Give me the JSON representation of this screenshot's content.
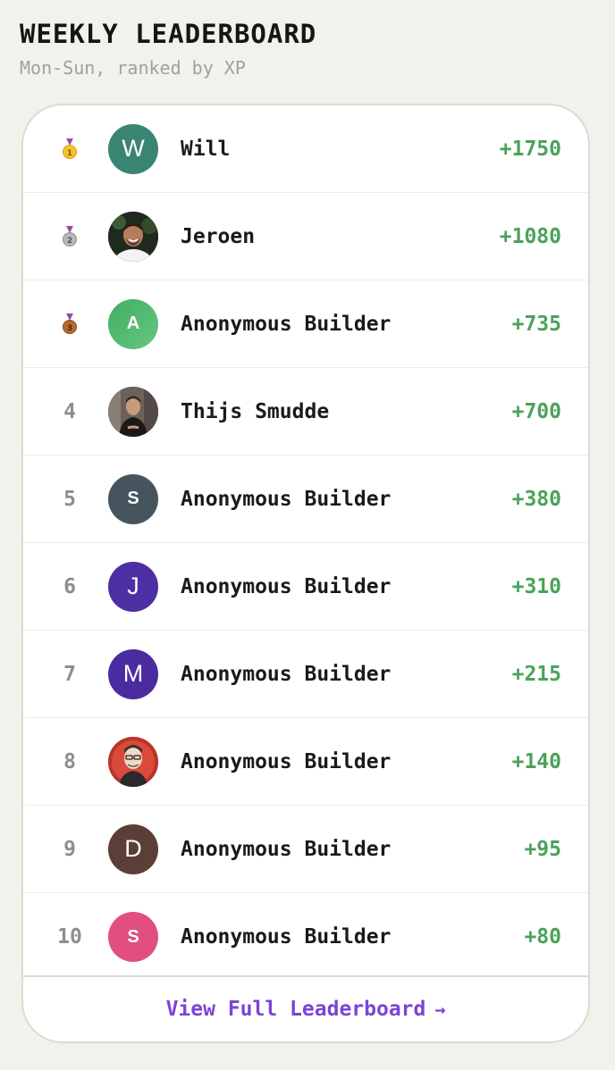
{
  "header": {
    "title": "WEEKLY LEADERBOARD",
    "subtitle": "Mon-Sun, ranked by XP"
  },
  "colors": {
    "xp_green": "#4aa25a",
    "link_purple": "#7a45d6",
    "gold": "#f2c230",
    "silver": "#a9a9a9",
    "bronze": "#b36b2f"
  },
  "rows": [
    {
      "rank": "1",
      "rank_icon": "gold-medal-icon",
      "avatar_initial": "W",
      "avatar_color": "#3a8474",
      "name": "Will",
      "xp": "+1750"
    },
    {
      "rank": "2",
      "rank_icon": "silver-medal-icon",
      "avatar_initial": "",
      "avatar_color": "#1f2a1e",
      "name": "Jeroen",
      "xp": "+1080"
    },
    {
      "rank": "3",
      "rank_icon": "bronze-medal-icon",
      "avatar_initial": "A",
      "avatar_color": "#4fb76c",
      "name": "Anonymous Builder",
      "xp": "+735"
    },
    {
      "rank": "4",
      "avatar_initial": "",
      "avatar_color": "#4a4340",
      "name": "Thijs Smudde",
      "xp": "+700"
    },
    {
      "rank": "5",
      "avatar_initial": "S",
      "avatar_color": "#46545e",
      "name": "Anonymous Builder",
      "xp": "+380"
    },
    {
      "rank": "6",
      "avatar_initial": "J",
      "avatar_color": "#4d2ea3",
      "name": "Anonymous Builder",
      "xp": "+310"
    },
    {
      "rank": "7",
      "avatar_initial": "M",
      "avatar_color": "#4b2ba0",
      "name": "Anonymous Builder",
      "xp": "+215"
    },
    {
      "rank": "8",
      "avatar_initial": "",
      "avatar_color": "#d94a3a",
      "name": "Anonymous Builder",
      "xp": "+140"
    },
    {
      "rank": "9",
      "avatar_initial": "D",
      "avatar_color": "#5b3e35",
      "name": "Anonymous Builder",
      "xp": "+95"
    },
    {
      "rank": "10",
      "avatar_initial": "S",
      "avatar_color": "#e04f7e",
      "name": "Anonymous Builder",
      "xp": "+80"
    }
  ],
  "footer": {
    "link_label": "View Full Leaderboard",
    "arrow": "→"
  }
}
